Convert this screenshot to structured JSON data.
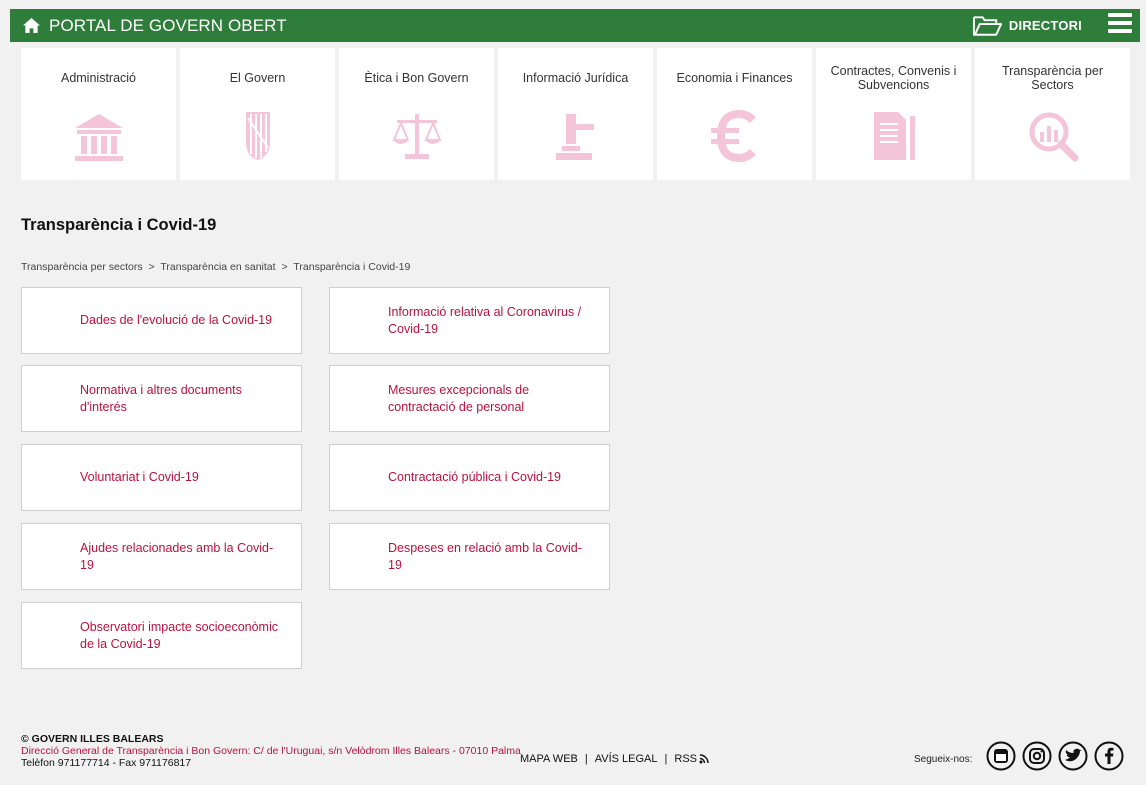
{
  "header": {
    "title": "PORTAL DE GOVERN OBERT",
    "directory_label": "DIRECTORI"
  },
  "categories": [
    {
      "label": "Administració",
      "icon": "bank-icon"
    },
    {
      "label": "El Govern",
      "icon": "coat-of-arms-icon"
    },
    {
      "label": "Ètica i Bon Govern",
      "icon": "scales-icon"
    },
    {
      "label": "Informació Jurídica",
      "icon": "gavel-icon"
    },
    {
      "label": "Economia i Finances",
      "icon": "euro-icon"
    },
    {
      "label": "Contractes, Convenis i Subvencions",
      "icon": "contract-icon"
    },
    {
      "label": "Transparència per Sectors",
      "icon": "magnifier-chart-icon"
    }
  ],
  "page": {
    "title": "Transparència i Covid-19",
    "breadcrumb": [
      "Transparència per sectors",
      "Transparència en sanitat",
      "Transparència i Covid-19"
    ],
    "breadcrumb_sep": ">"
  },
  "links": [
    "Dades de l'evolució de la Covid-19",
    "Informació relativa al Coronavirus / Covid-19",
    "Normativa i altres documents d'interés",
    "Mesures excepcionals de contractació de personal",
    "Voluntariat i Covid-19",
    "Contractació pública i Covid-19",
    "Ajudes relacionades amb la Covid-19",
    "Despeses en relació amb la Covid-19",
    "Observatori impacte socioeconòmic de la Covid-19"
  ],
  "footer": {
    "copyright": "© GOVERN ILLES BALEARS",
    "address": "Direcció General de Transparència i Bon Govern: C/ de l'Uruguai, s/n Velòdrom Illes Balears - 07010 Palma",
    "phone": "Telèfon 971177714 - Fax 971176817",
    "nav": [
      "MAPA WEB",
      "AVÍS LEGAL",
      "RSS"
    ],
    "nav_sep": "|",
    "follow_label": "Segueix-nos:",
    "social": [
      "youtube-icon",
      "instagram-icon",
      "twitter-icon",
      "facebook-icon"
    ]
  },
  "colors": {
    "header_bg": "#2f7d3a",
    "link_text": "#b8123f",
    "icon_pink": "#f4c4d9",
    "page_bg": "#f1f1f1"
  }
}
